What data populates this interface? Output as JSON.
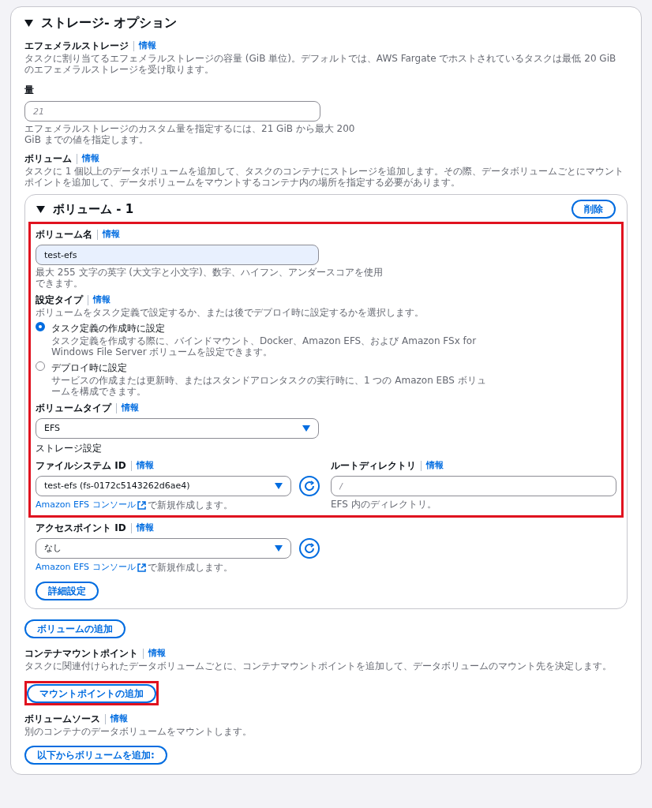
{
  "section": {
    "title": "ストレージ- オプション",
    "expanded": true
  },
  "ephemeral": {
    "label": "エフェメラルストレージ",
    "info": "情報",
    "description": "タスクに割り当てるエフェメラルストレージの容量 (GiB 単位)。デフォルトでは、AWS Fargate でホストされているタスクは最低 20 GiB のエフェメラルストレージを受け取ります。"
  },
  "amount": {
    "label": "量",
    "placeholder": "21",
    "hint": "エフェメラルストレージのカスタム量を指定するには、21 GiB から最大 200 GiB までの値を指定します。"
  },
  "volumes": {
    "label": "ボリューム",
    "info": "情報",
    "description": "タスクに 1 個以上のデータボリュームを追加して、タスクのコンテナにストレージを追加します。その際、データボリュームごとにマウントポイントを追加して、データボリュームをマウントするコンテナ内の場所を指定する必要があります。"
  },
  "volume_panel": {
    "title": "ボリューム - 1",
    "expanded": true,
    "remove_button": "削除",
    "name": {
      "label": "ボリューム名",
      "info": "情報",
      "value": "test-efs",
      "hint": "最大 255 文字の英字 (大文字と小文字)、数字、ハイフン、アンダースコアを使用できます。"
    },
    "config_type": {
      "label": "設定タイプ",
      "info": "情報",
      "description": "ボリュームをタスク定義で設定するか、または後でデプロイ時に設定するかを選択します。",
      "options": [
        {
          "label": "タスク定義の作成時に設定",
          "description": "タスク定義を作成する際に、バインドマウント、Docker、Amazon EFS、および Amazon FSx for Windows File Server ボリュームを設定できます。",
          "selected": true
        },
        {
          "label": "デプロイ時に設定",
          "description": "サービスの作成または更新時、またはスタンドアロンタスクの実行時に、1 つの Amazon EBS ボリュームを構成できます。",
          "selected": false
        }
      ]
    },
    "volume_type": {
      "label": "ボリュームタイプ",
      "info": "情報",
      "value": "EFS"
    },
    "storage_heading": "ストレージ設定",
    "file_system": {
      "label": "ファイルシステム ID",
      "info": "情報",
      "value": "test-efs (fs-0172c5143262d6ae4)",
      "link": "Amazon EFS コンソール",
      "link_suffix": "で新規作成します。"
    },
    "root_directory": {
      "label": "ルートディレクトリ",
      "info": "情報",
      "placeholder": "/",
      "hint": "EFS 内のディレクトリ。"
    },
    "access_point": {
      "label": "アクセスポイント ID",
      "info": "情報",
      "value": "なし",
      "link": "Amazon EFS コンソール",
      "link_suffix": "で新規作成します。"
    },
    "advanced_button": "詳細設定"
  },
  "add_volume_button": "ボリュームの追加",
  "mount_points": {
    "label": "コンテナマウントポイント",
    "info": "情報",
    "description": "タスクに関連付けられたデータボリュームごとに、コンテナマウントポイントを追加して、データボリュームのマウント先を決定します。",
    "button": "マウントポイントの追加",
    "highlighted": true
  },
  "volume_source": {
    "label": "ボリュームソース",
    "info": "情報",
    "description": "別のコンテナのデータボリュームをマウントします。",
    "button": "以下からボリュームを追加:"
  }
}
